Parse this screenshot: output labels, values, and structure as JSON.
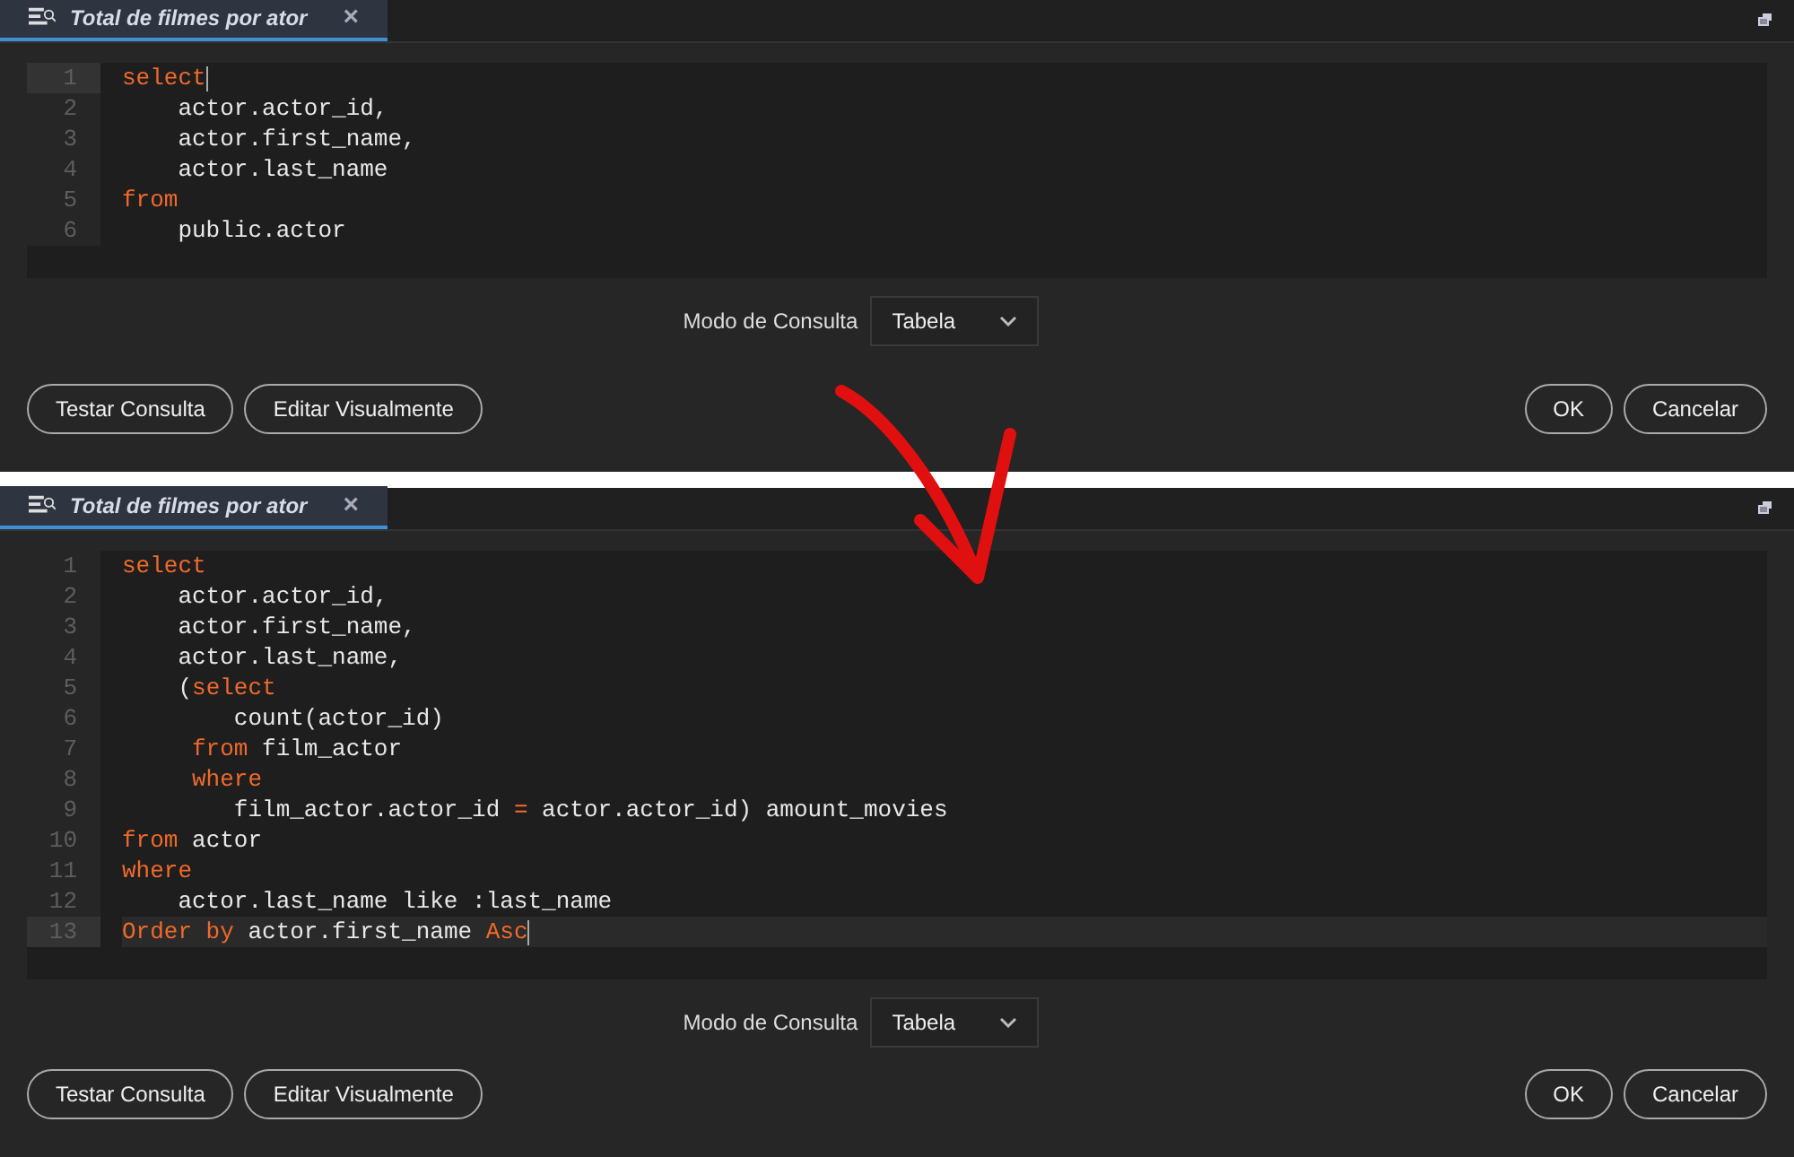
{
  "panels": [
    {
      "tab": {
        "title": "Total de filmes por ator",
        "close": "×",
        "selected": true
      },
      "lines": [
        {
          "number": "1",
          "active": true,
          "tokens": [
            {
              "kind": "keyword",
              "text": "select"
            }
          ]
        },
        {
          "number": "2",
          "active": false,
          "tokens": [
            {
              "kind": "plain",
              "text": "    actor.actor_id,"
            }
          ]
        },
        {
          "number": "3",
          "active": false,
          "tokens": [
            {
              "kind": "plain",
              "text": "    actor.first_name,"
            }
          ]
        },
        {
          "number": "4",
          "active": false,
          "tokens": [
            {
              "kind": "plain",
              "text": "    actor.last_name"
            }
          ]
        },
        {
          "number": "5",
          "active": false,
          "tokens": [
            {
              "kind": "keyword",
              "text": "from"
            }
          ]
        },
        {
          "number": "6",
          "active": false,
          "tokens": [
            {
              "kind": "plain",
              "text": "    public.actor"
            }
          ]
        }
      ],
      "mode_label": "Modo de Consulta",
      "mode_value": "Tabela",
      "left_buttons": [
        "Testar Consulta",
        "Editar Visualmente"
      ],
      "right_buttons": [
        "OK",
        "Cancelar"
      ]
    },
    {
      "tab": {
        "title": "Total de filmes por ator",
        "close": "×",
        "selected": true
      },
      "lines": [
        {
          "number": "1",
          "active": false,
          "tokens": [
            {
              "kind": "keyword",
              "text": "select"
            }
          ]
        },
        {
          "number": "2",
          "active": false,
          "tokens": [
            {
              "kind": "plain",
              "text": "    actor.actor_id,"
            }
          ]
        },
        {
          "number": "3",
          "active": false,
          "tokens": [
            {
              "kind": "plain",
              "text": "    actor.first_name,"
            }
          ]
        },
        {
          "number": "4",
          "active": false,
          "tokens": [
            {
              "kind": "plain",
              "text": "    actor.last_name,"
            }
          ]
        },
        {
          "number": "5",
          "active": false,
          "tokens": [
            {
              "kind": "plain",
              "text": "    ("
            },
            {
              "kind": "keyword",
              "text": "select"
            }
          ]
        },
        {
          "number": "6",
          "active": false,
          "tokens": [
            {
              "kind": "plain",
              "text": "        count(actor_id)"
            }
          ]
        },
        {
          "number": "7",
          "active": false,
          "tokens": [
            {
              "kind": "keyword",
              "text": "     from"
            },
            {
              "kind": "plain",
              "text": " film_actor"
            }
          ]
        },
        {
          "number": "8",
          "active": false,
          "tokens": [
            {
              "kind": "keyword",
              "text": "     where"
            }
          ]
        },
        {
          "number": "9",
          "active": false,
          "tokens": [
            {
              "kind": "plain",
              "text": "        film_actor.actor_id "
            },
            {
              "kind": "keyword",
              "text": "="
            },
            {
              "kind": "plain",
              "text": " actor.actor_id) amount_movies"
            }
          ]
        },
        {
          "number": "10",
          "active": false,
          "tokens": [
            {
              "kind": "keyword",
              "text": "from"
            },
            {
              "kind": "plain",
              "text": " actor"
            }
          ]
        },
        {
          "number": "11",
          "active": false,
          "tokens": [
            {
              "kind": "keyword",
              "text": "where"
            }
          ]
        },
        {
          "number": "12",
          "active": false,
          "tokens": [
            {
              "kind": "plain",
              "text": "    actor.last_name like :last_name"
            }
          ]
        },
        {
          "number": "13",
          "active": true,
          "tokens": [
            {
              "kind": "keyword",
              "text": "Order by"
            },
            {
              "kind": "plain",
              "text": " actor.first_name "
            },
            {
              "kind": "keyword",
              "text": "Asc"
            }
          ]
        }
      ],
      "mode_label": "Modo de Consulta",
      "mode_value": "Tabela",
      "left_buttons": [
        "Testar Consulta",
        "Editar Visualmente"
      ],
      "right_buttons": [
        "OK",
        "Cancelar"
      ]
    }
  ]
}
